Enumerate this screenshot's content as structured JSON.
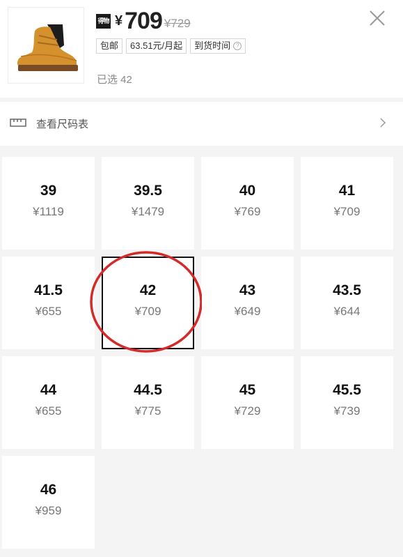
{
  "product": {
    "brand_badge": "得物",
    "currency": "¥",
    "price": "709",
    "original_price": "¥729",
    "tags": [
      "包邮",
      "63.51元/月起",
      "到货时间"
    ],
    "help_icon": "?",
    "selected_label": "已选 42"
  },
  "size_chart": {
    "label": "查看尺码表"
  },
  "sizes": [
    {
      "size": "39",
      "price": "¥1119"
    },
    {
      "size": "39.5",
      "price": "¥1479"
    },
    {
      "size": "40",
      "price": "¥769"
    },
    {
      "size": "41",
      "price": "¥709"
    },
    {
      "size": "41.5",
      "price": "¥655"
    },
    {
      "size": "42",
      "price": "¥709",
      "selected": true
    },
    {
      "size": "43",
      "price": "¥649"
    },
    {
      "size": "43.5",
      "price": "¥644"
    },
    {
      "size": "44",
      "price": "¥655"
    },
    {
      "size": "44.5",
      "price": "¥775"
    },
    {
      "size": "45",
      "price": "¥729"
    },
    {
      "size": "45.5",
      "price": "¥739"
    },
    {
      "size": "46",
      "price": "¥959"
    }
  ],
  "colors": {
    "highlight_circle": "#d42a2a",
    "selected_border": "#111111"
  }
}
